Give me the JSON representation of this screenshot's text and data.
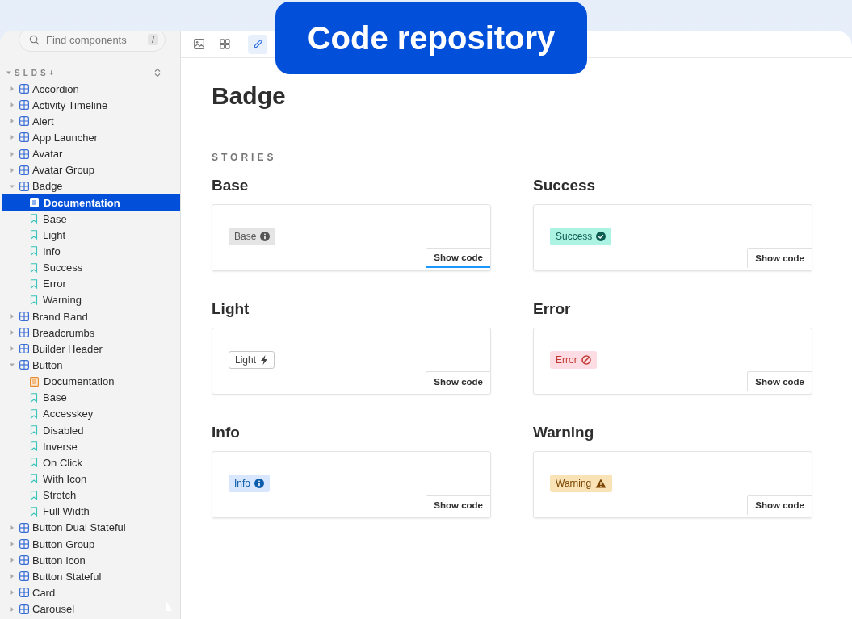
{
  "overlay_label": "Code repository",
  "search": {
    "placeholder": "Find components",
    "shortcut": "/"
  },
  "toolbar": [
    {
      "kind": "image",
      "selected": false
    },
    {
      "kind": "grid",
      "selected": false
    },
    {
      "kind": "pencil",
      "selected": true
    }
  ],
  "tree": {
    "label": "SLDS+",
    "expanded": true,
    "children": [
      {
        "label": "Accordion",
        "expanded": false
      },
      {
        "label": "Activity Timeline",
        "expanded": false
      },
      {
        "label": "Alert",
        "expanded": false
      },
      {
        "label": "App Launcher",
        "expanded": false
      },
      {
        "label": "Avatar",
        "expanded": false
      },
      {
        "label": "Avatar Group",
        "expanded": false
      },
      {
        "label": "Badge",
        "expanded": true,
        "children": [
          {
            "label": "Documentation",
            "kind": "docs",
            "selected": true
          },
          {
            "label": "Base",
            "kind": "story",
            "selected": false
          },
          {
            "label": "Light",
            "kind": "story",
            "selected": false
          },
          {
            "label": "Info",
            "kind": "story",
            "selected": false
          },
          {
            "label": "Success",
            "kind": "story",
            "selected": false
          },
          {
            "label": "Error",
            "kind": "story",
            "selected": false
          },
          {
            "label": "Warning",
            "kind": "story",
            "selected": false
          }
        ]
      },
      {
        "label": "Brand Band",
        "expanded": false
      },
      {
        "label": "Breadcrumbs",
        "expanded": false
      },
      {
        "label": "Builder Header",
        "expanded": false
      },
      {
        "label": "Button",
        "expanded": true,
        "children": [
          {
            "label": "Documentation",
            "kind": "docs",
            "selected": false
          },
          {
            "label": "Base",
            "kind": "story",
            "selected": false
          },
          {
            "label": "Accesskey",
            "kind": "story",
            "selected": false
          },
          {
            "label": "Disabled",
            "kind": "story",
            "selected": false
          },
          {
            "label": "Inverse",
            "kind": "story",
            "selected": false
          },
          {
            "label": "On Click",
            "kind": "story",
            "selected": false
          },
          {
            "label": "With Icon",
            "kind": "story",
            "selected": false
          },
          {
            "label": "Stretch",
            "kind": "story",
            "selected": false
          },
          {
            "label": "Full Width",
            "kind": "story",
            "selected": false
          }
        ]
      },
      {
        "label": "Button Dual Stateful",
        "expanded": false
      },
      {
        "label": "Button Group",
        "expanded": false
      },
      {
        "label": "Button Icon",
        "expanded": false
      },
      {
        "label": "Button Stateful",
        "expanded": false
      },
      {
        "label": "Card",
        "expanded": false
      },
      {
        "label": "Carousel",
        "expanded": false
      }
    ]
  },
  "page": {
    "title": "Badge",
    "section": "STORIES",
    "stories": [
      {
        "title": "Base",
        "badge": "Base",
        "kind": "base",
        "button": "Show code",
        "focused": true
      },
      {
        "title": "Success",
        "badge": "Success",
        "kind": "success",
        "button": "Show code",
        "focused": false
      },
      {
        "title": "Light",
        "badge": "Light",
        "kind": "light",
        "button": "Show code",
        "focused": false
      },
      {
        "title": "Error",
        "badge": "Error",
        "kind": "error",
        "button": "Show code",
        "focused": false
      },
      {
        "title": "Info",
        "badge": "Info",
        "kind": "info",
        "button": "Show code",
        "focused": false
      },
      {
        "title": "Warning",
        "badge": "Warning",
        "kind": "warning",
        "button": "Show code",
        "focused": false
      }
    ]
  }
}
